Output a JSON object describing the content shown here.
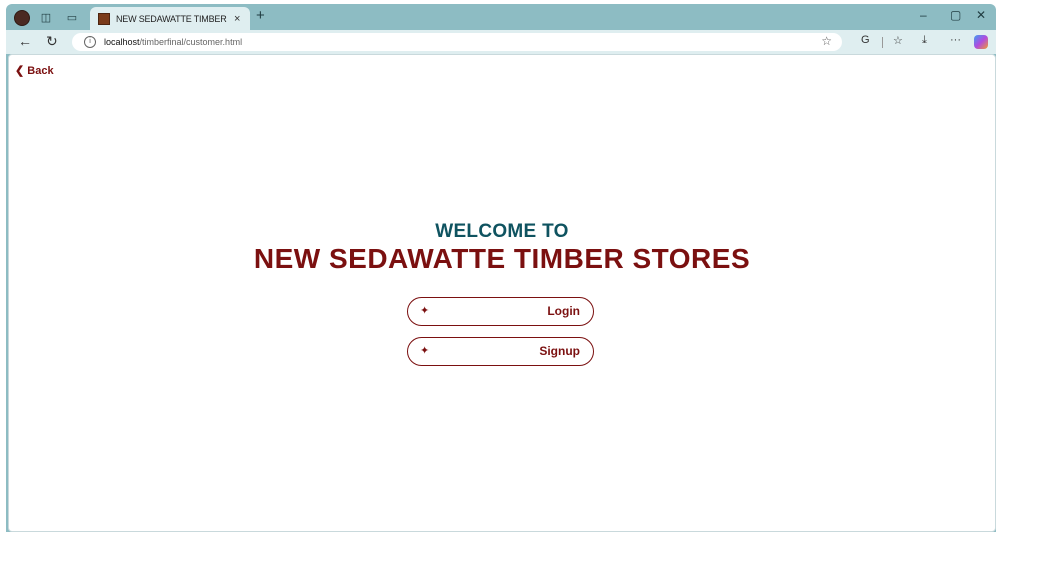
{
  "browser": {
    "tab_title": "NEW SEDAWATTE TIMBER STORE",
    "tab_close": "×",
    "new_tab": "+",
    "url_host": "localhost",
    "url_path": "/timberfinal/customer.html",
    "window_controls": {
      "minimize": "–",
      "maximize": "▢",
      "close": "✕"
    }
  },
  "page": {
    "back_label": "❮ Back",
    "welcome": "WELCOME TO",
    "store_name": "NEW SEDAWATTE TIMBER STORES",
    "buttons": {
      "login": "Login",
      "signup": "Signup",
      "icon_glyph": "✦"
    }
  },
  "colors": {
    "maroon": "#7b1010",
    "teal": "#0f5360",
    "chrome": "#8dbcc3"
  }
}
